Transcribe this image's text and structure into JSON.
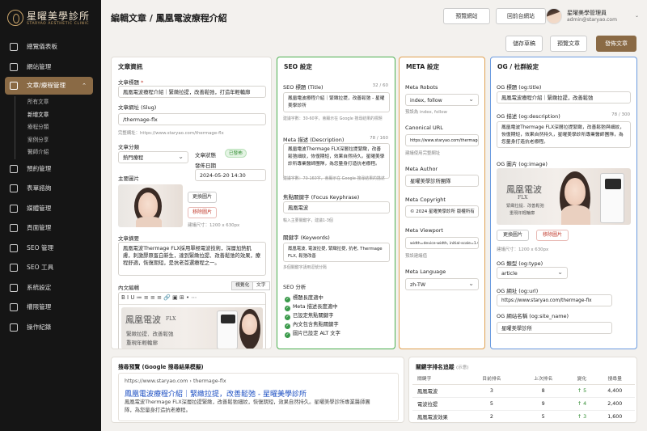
{
  "brand": {
    "name": "星曜美學診所",
    "sub": "STARYAO AESTHETIC CLINIC"
  },
  "sidebar": {
    "items": [
      {
        "label": "總覽儀表板",
        "icon": "dashboard-icon"
      },
      {
        "label": "網站管理",
        "icon": "website-icon"
      },
      {
        "label": "文章/療程管理",
        "icon": "article-icon"
      },
      {
        "label": "預約管理",
        "icon": "calendar-icon"
      },
      {
        "label": "表單諮詢",
        "icon": "form-icon"
      },
      {
        "label": "媒體管理",
        "icon": "media-icon"
      },
      {
        "label": "頁面管理",
        "icon": "page-icon"
      },
      {
        "label": "SEO 管理",
        "icon": "seo-icon"
      },
      {
        "label": "SEO 工具",
        "icon": "seo-tool-icon"
      },
      {
        "label": "系統設定",
        "icon": "settings-icon"
      },
      {
        "label": "權限管理",
        "icon": "user-icon"
      },
      {
        "label": "操作紀錄",
        "icon": "history-icon"
      }
    ],
    "sub_items": [
      "所有文章",
      "新增文章",
      "療程分類",
      "案例分享",
      "醫師介紹"
    ]
  },
  "header": {
    "breadcrumb_parent": "編輯文章",
    "separator": "/",
    "breadcrumb_current": "鳳凰電波療程介紹",
    "preview_site": "預覽網站",
    "front_site": "回前台網站",
    "user_name": "星曜美學管理員",
    "user_email": "admin@staryao.com"
  },
  "actions": {
    "draft": "儲存草稿",
    "preview": "預覽文章",
    "publish": "發佈文章"
  },
  "article": {
    "section_title": "文章資訊",
    "title_label": "文章標題",
    "title_required": "*",
    "title_value": "鳳凰電波療程介紹｜緊緻拉提，改善鬆弛，打造年輕輪廓",
    "slug_label": "文章網址 (Slug)",
    "slug_value": "/thermage-flx",
    "full_url": "完整網址：https://www.staryao.com/thermage-flx",
    "category_label": "文章分類",
    "category_value": "熱門療程",
    "status_label": "文章狀態",
    "status_value": "已發佈",
    "publish_time_label": "發佈日期",
    "publish_time_value": "2024-05-20 14:30",
    "image_label": "主要圖片",
    "replace_image": "更換圖片",
    "remove_image": "移除圖片",
    "image_size_hint": "建議尺寸：1200 x 630px",
    "summary_label": "文章摘要",
    "summary_value": "鳳凰電波Thermage FLX採用單極電波技術，深層加熱肌膚，刺激膠原蛋白新生，達到緊緻拉提、改善鬆弛的效果，療程舒適，恢復期短，是抗老首選療程之一。",
    "content_label": "內文編輯",
    "visual_tab": "視覺化",
    "text_tab": "文字",
    "toolbar_icons": "B  I  U  ≔  ≡  ≡  ≡  🔗  ▣  ⊞  •  ⋯",
    "content_image_title": "鳳凰電波",
    "content_image_flx": "FLX",
    "content_image_line1": "緊緻拉提．改善鬆弛",
    "content_image_line2": "重現年輕輪廓"
  },
  "seo": {
    "section_title": "SEO 設定",
    "title_label": "SEO 標題 (Title)",
    "title_count": "32 / 60",
    "title_value": "鳳凰電波療程介紹｜緊緻拉提，改善鬆弛 - 星曜美學診所",
    "title_hint": "建議字數：30-60字，會顯示在 Google 搜尋結果的標題",
    "desc_label": "Meta 描述 (Description)",
    "desc_count": "78 / 160",
    "desc_value": "鳳凰電波Thermage FLX深層拉提緊緻，改善鬆弛細紋，恢復期短，效果自然持久。星曜美學診所專業醫師團隊，為您量身打造抗老療程。",
    "desc_hint": "建議字數：70-160字，會顯示在 Google 搜尋結果的描述",
    "focus_label": "焦點關鍵字 (Focus Keyphrase)",
    "focus_value": "鳳凰電波",
    "focus_hint": "輸入主要關鍵字，建議1-3個",
    "keywords_label": "關鍵字 (Keywords)",
    "keywords_value": "鳳凰電波, 電波拉提, 緊緻拉提, 抗老, Thermage FLX, 鬆弛改善",
    "keywords_hint": "多個關鍵字請用逗號分隔",
    "analysis_label": "SEO 分析",
    "checks": [
      "標題長度適中",
      "Meta 描述長度適中",
      "已設定焦點關鍵字",
      "內文包含焦點關鍵字",
      "圖片已設定 ALT 文字"
    ]
  },
  "meta": {
    "section_title": "META 設定",
    "robots_label": "Meta Robots",
    "robots_value": "index, follow",
    "robots_hint": "預設為 index, follow",
    "canonical_label": "Canonical URL",
    "canonical_value": "https://www.staryao.com/thermage-flx",
    "canonical_hint": "建議使用完整網址",
    "author_label": "Meta Author",
    "author_value": "星曜美學診所團隊",
    "copyright_label": "Meta Copyright",
    "copyright_value": "© 2024 星曜美學診所 版權所有",
    "viewport_label": "Meta Viewport",
    "viewport_value": "width=device-width, initial-scale=1.0",
    "viewport_hint": "預設建議值",
    "language_label": "Meta Language",
    "language_value": "zh-TW"
  },
  "og": {
    "section_title": "OG / 社群設定",
    "title_label": "OG 標題 (og:title)",
    "title_value": "鳳凰電波療程介紹｜緊緻拉提，改善鬆弛",
    "desc_label": "OG 描述 (og:description)",
    "desc_count": "78 / 300",
    "desc_value": "鳳凰電波Thermage FLX深層拉提緊緻，改善鬆弛與細紋，恢復期短，效果自然持久，星曜美學診所專業醫師團隊，為您量身打造抗老療程。",
    "image_label": "OG 圖片 (og:image)",
    "image_title": "鳳凰電波",
    "image_flx": "FLX",
    "image_line1": "緊緻拉提．改善鬆弛",
    "image_line2": "重現年輕輪廓",
    "replace_image": "更換圖片",
    "remove_image": "移除圖片",
    "image_hint": "建議尺寸：1200 x 630px",
    "type_label": "OG 類型 (og:type)",
    "type_value": "article",
    "url_label": "OG 網址 (og:url)",
    "url_value": "https://www.staryao.com/thermage-flx",
    "site_label": "OG 網站名稱 (og:site_name)",
    "site_value": "星曜美學診所"
  },
  "serp": {
    "section_title": "搜尋預覽 (Google 搜尋結果模擬)",
    "url": "https://www.staryao.com › thermage-flx",
    "title": "鳳凰電波療程介紹｜緊緻拉提，改善鬆弛 - 星曜美學診所",
    "desc": "鳳凰電波Thermage FLX深層拉提緊緻，改善鬆弛細紋，恢復期短，效果自然持久。星曜美學診所專業醫師團隊，為您量身打造抗老療程。"
  },
  "ranking": {
    "section_title": "關鍵字排名追蹤",
    "demo_tag": "(示意)",
    "columns": [
      "關鍵字",
      "目前排名",
      "上次排名",
      "變化",
      "搜尋量"
    ],
    "rows": [
      {
        "keyword": "鳳凰電波",
        "current": "3",
        "last": "8",
        "change": "↑ 5",
        "volume": "4,400"
      },
      {
        "keyword": "電波拉提",
        "current": "5",
        "last": "9",
        "change": "↑ 4",
        "volume": "2,400"
      },
      {
        "keyword": "鳳凰電波效果",
        "current": "2",
        "last": "5",
        "change": "↑ 3",
        "volume": "1,600"
      }
    ]
  },
  "colors": {
    "brand": "#8a6a45",
    "seo_border": "#4caf50",
    "meta_border": "#e0a050",
    "og_border": "#6b9be0",
    "sidebar_bg": "#151515"
  }
}
